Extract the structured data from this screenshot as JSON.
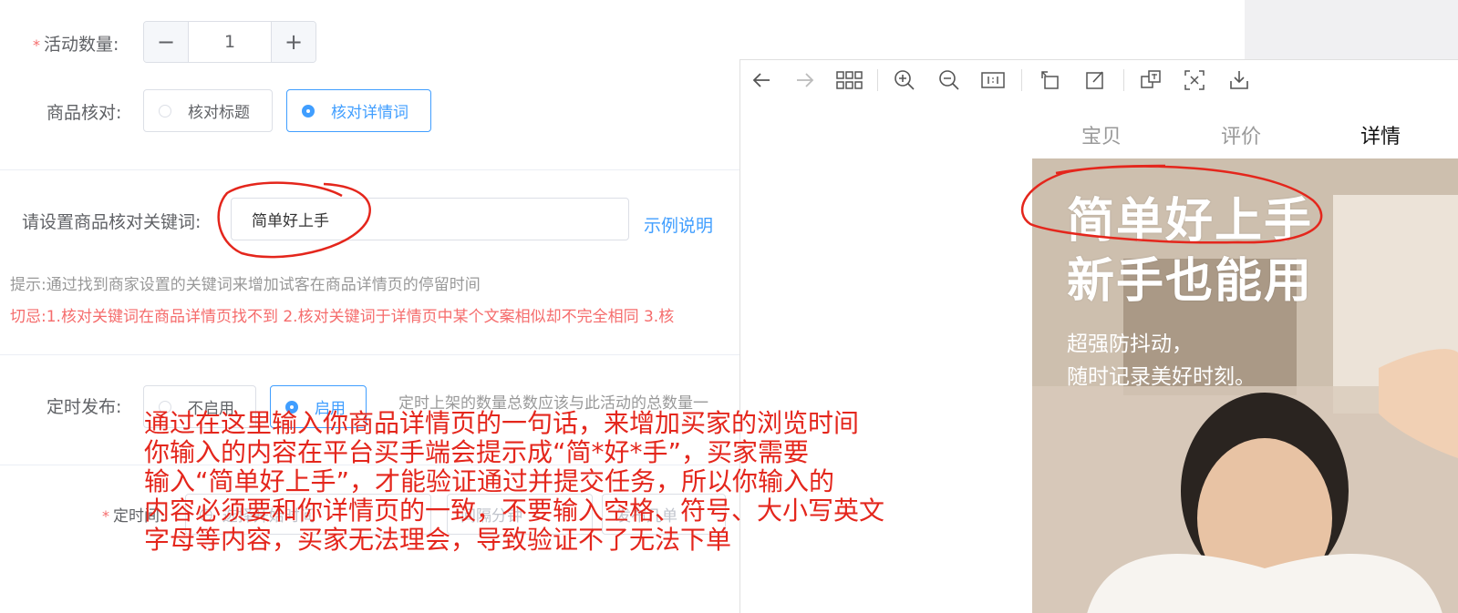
{
  "form": {
    "activity_count": {
      "label": "活动数量:",
      "value": "1",
      "minus": "−",
      "plus": "+"
    },
    "verify": {
      "label": "商品核对:",
      "option_title": "核对标题",
      "option_detail": "核对详情词"
    },
    "keyword": {
      "label": "请设置商品核对关键词:",
      "value": "简单好上手",
      "example_link": "示例说明",
      "hint": "提示:通过找到商家设置的关键词来增加试客在商品详情页的停留时间",
      "warning": "切忌:1.核对关键词在商品详情页找不到 2.核对关键词于详情页中某个文案相似却不完全相同 3.核"
    },
    "schedule": {
      "label": "定时发布:",
      "option_off": "不启用",
      "option_on": "启用",
      "note": "定时上架的数量总数应该与此活动的总数量一"
    },
    "timing": {
      "label": "定时间:",
      "start_placeholder": "选择开始时间",
      "interval_placeholder": "间隔分钟",
      "unit_placeholder": "发布几单"
    }
  },
  "viewer": {
    "tabs": [
      "宝贝",
      "评价",
      "详情"
    ],
    "active_tab": 2,
    "product": {
      "title_line1": "简单好上手",
      "title_line2": "新手也能用",
      "sub_line1": "超强防抖动，",
      "sub_line2": "随时记录美好时刻。"
    },
    "toolbar_icons": [
      "arrow-left-icon",
      "arrow-right-icon",
      "grid-icon",
      "zoom-in-icon",
      "zoom-out-icon",
      "actual-size-icon",
      "rotate-icon",
      "edit-icon",
      "translate-icon",
      "ocr-icon",
      "download-icon"
    ]
  },
  "annotation": {
    "lines": [
      "通过在这里输入你商品详情页的一句话，来增加买家的浏览时间",
      "你输入的内容在平台买手端会提示成“简*好*手”，买家需要",
      "输入“简单好上手”，才能验证通过并提交任务，所以你输入的",
      "内容必须要和你详情页的一致，不要输入空格、符号、大小写英文",
      "字母等内容，买家无法理会，导致验证不了无法下单"
    ],
    "color": "#e4261c"
  }
}
